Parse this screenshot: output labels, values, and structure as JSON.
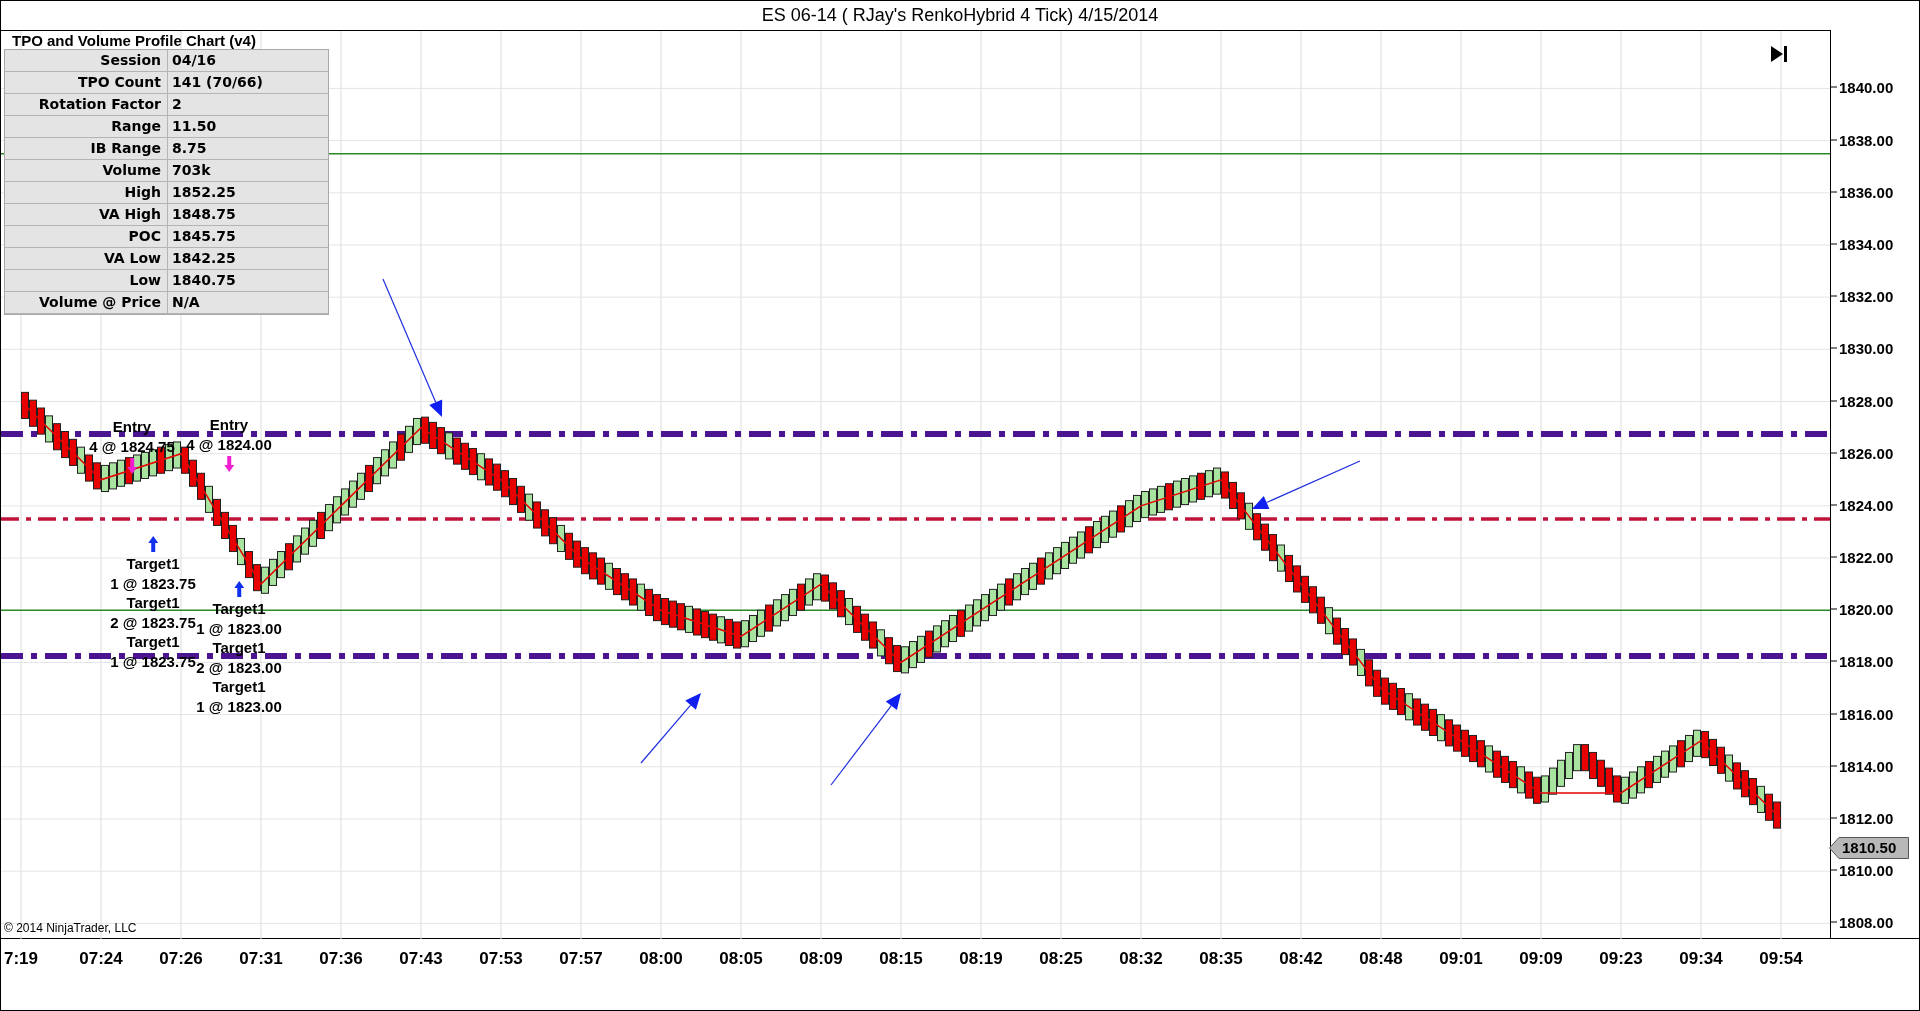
{
  "window": {
    "title": "ES 06-14 ( RJay's RenkoHybrid  4 Tick)  4/15/2014"
  },
  "stats_panel": {
    "title": "TPO and Volume Profile Chart (v4)",
    "rows": [
      {
        "label": "Session",
        "value": "04/16"
      },
      {
        "label": "TPO Count",
        "value": "141 (70/66)"
      },
      {
        "label": "Rotation Factor",
        "value": "2"
      },
      {
        "label": "Range",
        "value": "11.50"
      },
      {
        "label": "IB Range",
        "value": "8.75"
      },
      {
        "label": "Volume",
        "value": "703k"
      },
      {
        "label": "High",
        "value": "1852.25"
      },
      {
        "label": "VA High",
        "value": "1848.75"
      },
      {
        "label": "POC",
        "value": "1845.75"
      },
      {
        "label": "VA Low",
        "value": "1842.25"
      },
      {
        "label": "Low",
        "value": "1840.75"
      },
      {
        "label": "Volume @ Price",
        "value": "N/A"
      }
    ]
  },
  "chart": {
    "chart_data": {
      "type": "line",
      "categories": [
        "7:19",
        "07:24",
        "07:26",
        "07:31",
        "07:36",
        "07:43",
        "07:53",
        "07:57",
        "08:00",
        "08:05",
        "08:09",
        "08:15",
        "08:19",
        "08:25",
        "08:32",
        "08:35",
        "08:42",
        "08:48",
        "09:01",
        "09:09",
        "09:23",
        "09:34",
        "09:54"
      ],
      "grid": true,
      "series": [
        {
          "color": "#e80000",
          "values": [
            1828,
            1825,
            1826,
            1821,
            1824,
            1827,
            1825,
            1822,
            1820,
            1819,
            1821,
            1818,
            1820,
            1822,
            1824,
            1825,
            1821,
            1817,
            1815,
            1813,
            1813,
            1815,
            1812
          ]
        }
      ],
      "ylim": [
        1807.4,
        1842.2
      ],
      "yticks": [
        {
          "value": 1808,
          "label": "1808.00"
        },
        {
          "value": 1810,
          "label": "1810.00"
        },
        {
          "value": 1812,
          "label": "1812.00"
        },
        {
          "value": 1814,
          "label": "1814.00"
        },
        {
          "value": 1816,
          "label": "1816.00"
        },
        {
          "value": 1818,
          "label": "1818.00"
        },
        {
          "value": 1820,
          "label": "1820.00"
        },
        {
          "value": 1822,
          "label": "1822.00"
        },
        {
          "value": 1824,
          "label": "1824.00"
        },
        {
          "value": 1826,
          "label": "1826.00"
        },
        {
          "value": 1828,
          "label": "1828.00"
        },
        {
          "value": 1830,
          "label": "1830.00"
        },
        {
          "value": 1832,
          "label": "1832.00"
        },
        {
          "value": 1834,
          "label": "1834.00"
        },
        {
          "value": 1836,
          "label": "1836.00"
        },
        {
          "value": 1838,
          "label": "1838.00"
        },
        {
          "value": 1840,
          "label": "1840.00"
        }
      ],
      "ref_lines": [
        {
          "axis": "y",
          "value": 1837.5,
          "color": "#2a8a2a"
        },
        {
          "axis": "y",
          "value": 1826.75,
          "color": "#4b1490"
        },
        {
          "axis": "y",
          "value": 1823.5,
          "color": "#c0143c"
        },
        {
          "axis": "y",
          "value": 1820,
          "color": "#2a8a2a"
        },
        {
          "axis": "y",
          "value": 1818.25,
          "color": "#4b1490"
        }
      ]
    },
    "last_price": {
      "label": "1810.50"
    },
    "trade_markers": [
      {
        "kind": "entry",
        "lines": [
          "Entry",
          "4 @ 1824.75"
        ]
      },
      {
        "kind": "entry",
        "lines": [
          "Entry",
          "4 @ 1824.00"
        ]
      },
      {
        "kind": "target",
        "lines": [
          "Target1",
          "1 @ 1823.75",
          "Target1",
          "2 @ 1823.75",
          "Target1",
          "1 @ 1823.75"
        ]
      },
      {
        "kind": "target",
        "lines": [
          "Target1",
          "1 @ 1823.00",
          "Target1",
          "2 @ 1823.00",
          "Target1",
          "1 @ 1823.00"
        ]
      }
    ],
    "copyright": "© 2014 NinjaTrader, LLC"
  }
}
